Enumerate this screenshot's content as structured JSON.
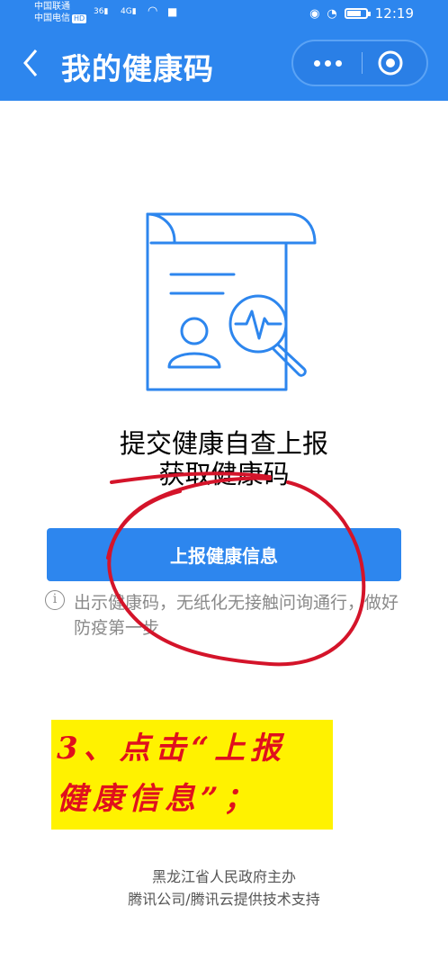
{
  "status_bar": {
    "carrier1": "中国联通",
    "carrier2": "中国电信",
    "hd": "HD",
    "sig1": "36",
    "sig2": "4G",
    "time": "12:19"
  },
  "nav": {
    "title": "我的健康码"
  },
  "content": {
    "heading_line1": "提交健康自查上报",
    "heading_line2": "获取健康码",
    "report_button": "上报健康信息",
    "hint": "出示健康码，无纸化无接触问询通行，做好防疫第一步"
  },
  "annotation": {
    "line1": "3、点击“上报",
    "line2": "健康信息”；"
  },
  "footer": {
    "line1": "黑龙江省人民政府主办",
    "line2": "腾讯公司/腾讯云提供技术支持"
  },
  "colors": {
    "primary": "#2d86ee",
    "annotation_bg": "#fff200",
    "annotation_text": "#e0101d",
    "scribble": "#d4142a"
  },
  "icons": [
    "back-icon",
    "more-icon",
    "close-target-icon",
    "document-search-illustration",
    "info-icon"
  ]
}
